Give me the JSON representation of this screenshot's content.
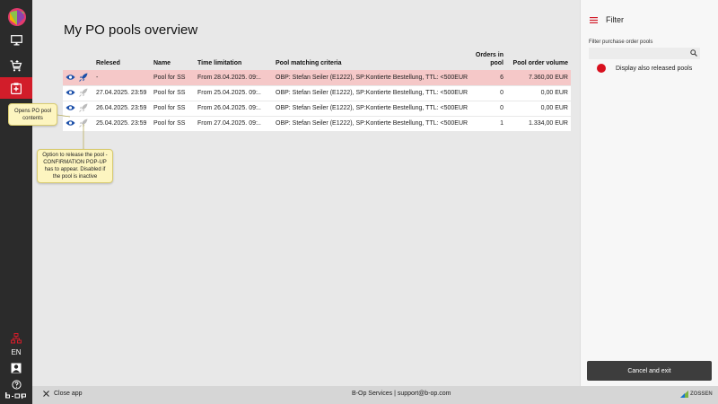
{
  "sidebar": {
    "language": "EN",
    "items": [
      {
        "icon": "monitor-icon"
      },
      {
        "icon": "cart-add-icon"
      },
      {
        "icon": "clipboard-icon",
        "active": true
      }
    ],
    "bottom_icons": [
      "network-icon",
      "user-icon",
      "help-icon"
    ],
    "logo_text": "b-op"
  },
  "main": {
    "title": "My PO pools overview",
    "columns": {
      "released": "Relesed",
      "name": "Name",
      "time": "Time limitation",
      "criteria": "Pool matching criteria",
      "orders": "Orders in pool",
      "volume": "Pool order volume"
    },
    "rows": [
      {
        "released": "-",
        "name": "Pool for SS",
        "time": "From 28.04.2025. 09:..",
        "criteria": "OBP: Stefan Seiler (E1222), SP:Kontierte Bestellung, TTL: <500EUR",
        "orders": "6",
        "volume": "7.360,00 EUR",
        "highlight": true
      },
      {
        "released": "27.04.2025. 23:59",
        "name": "Pool for SS",
        "time": "From 25.04.2025. 09:..",
        "criteria": "OBP: Stefan Seiler (E1222), SP:Kontierte Bestellung, TTL: <500EUR",
        "orders": "0",
        "volume": "0,00 EUR"
      },
      {
        "released": "26.04.2025. 23:59",
        "name": "Pool for SS",
        "time": "From 26.04.2025. 09:..",
        "criteria": "OBP: Stefan Seiler (E1222), SP:Kontierte Bestellung, TTL: <500EUR",
        "orders": "0",
        "volume": "0,00 EUR"
      },
      {
        "released": "25.04.2025. 23:59",
        "name": "Pool for SS",
        "time": "From 27.04.2025. 09:..",
        "criteria": "OBP: Stefan Seiler (E1222), SP:Kontierte Bestellung, TTL: <500EUR",
        "orders": "1",
        "volume": "1.334,00 EUR"
      }
    ],
    "tooltip_open": "Opens PO pool contents",
    "tooltip_release": "Option to release the pool - CONFIRMATION POP-UP has to appear. Disabled if the pool is inactive"
  },
  "filter": {
    "title": "Filter",
    "input_label": "Filter purchase order pools",
    "input_placeholder": "",
    "released_label": "Display also released pools",
    "button": "Cancel and exit"
  },
  "footer": {
    "close": "Close app",
    "services": "B-Op Services | support@b-op.com",
    "brand": "ZOSSEN"
  },
  "colors": {
    "accent": "#d21d2a",
    "highlight_row": "#f5c8c8",
    "icon_blue": "#1a4ea8"
  }
}
